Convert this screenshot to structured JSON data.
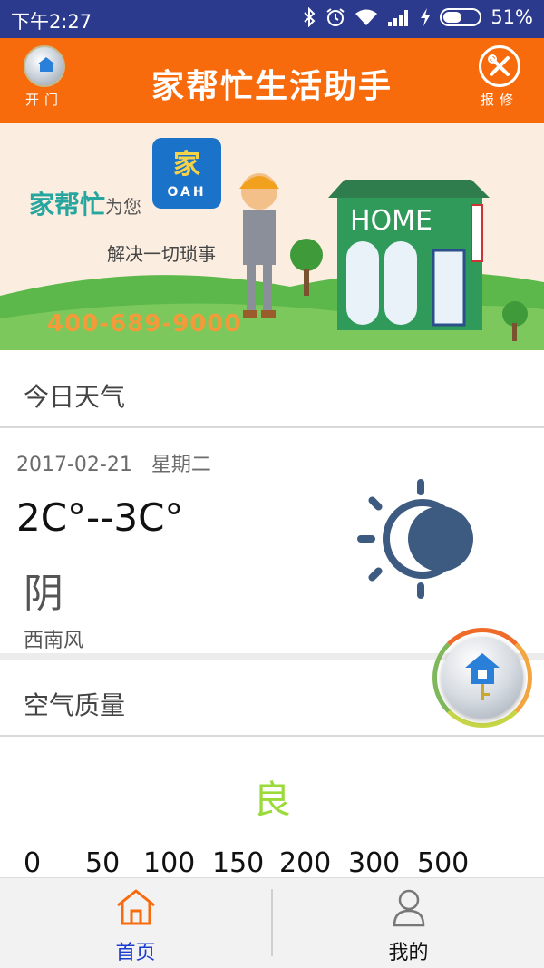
{
  "status_bar": {
    "time": "下午2:27",
    "battery": "51%",
    "battery_level": 0.51,
    "icons": [
      "bluetooth-icon",
      "alarm-icon",
      "wifi-icon",
      "signal-icon",
      "charging-icon",
      "battery-icon"
    ]
  },
  "header": {
    "title": "家帮忙生活助手",
    "left_button": {
      "label": "开门",
      "icon": "door-key-icon"
    },
    "right_button": {
      "label": "报修",
      "icon": "repair-tools-icon"
    },
    "color": "#f76b0d"
  },
  "banner": {
    "brand": "家帮忙",
    "brand_suffix": "为您",
    "slogan": "解决一切琐事",
    "phone": "400-689-9000",
    "logo_text": "家",
    "logo_sub": "OAH",
    "home_sign": "HOME"
  },
  "weather": {
    "section_title": "今日天气",
    "date": "2017-02-21",
    "weekday": "星期二",
    "temperature": "2C°--3C°",
    "condition": "阴",
    "wind": "西南风",
    "icon": "sun-behind-cloud-icon"
  },
  "air_quality": {
    "section_title": "空气质量",
    "level": "良",
    "level_color": "#9adb3a",
    "scale": [
      "0",
      "50",
      "100",
      "150",
      "200",
      "300",
      "500"
    ]
  },
  "bottom_nav": {
    "tabs": [
      {
        "label": "首页",
        "icon": "home-icon",
        "active": true
      },
      {
        "label": "我的",
        "icon": "user-icon",
        "active": false
      }
    ],
    "active_color": "#1a3ccf",
    "inactive_color": "#111111"
  }
}
